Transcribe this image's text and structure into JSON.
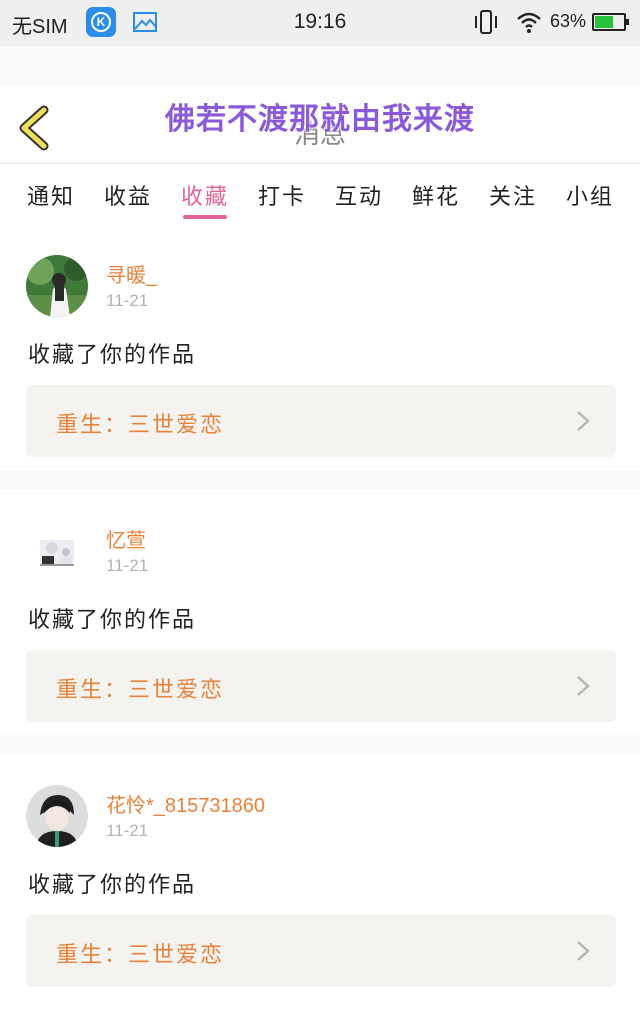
{
  "status_bar": {
    "carrier": "无SIM",
    "time": "19:16",
    "battery_percent": "63%",
    "battery_level": 0.63,
    "icons": [
      "k-app-icon",
      "gallery-icon",
      "vibrate-icon",
      "wifi-icon",
      "battery-icon"
    ]
  },
  "header": {
    "title": "消息",
    "overlay_text": "佛若不渡那就由我来渡"
  },
  "tabs": [
    {
      "label": "通知"
    },
    {
      "label": "收益"
    },
    {
      "label": "收藏"
    },
    {
      "label": "打卡"
    },
    {
      "label": "互动"
    },
    {
      "label": "鲜花"
    },
    {
      "label": "关注"
    },
    {
      "label": "小组"
    }
  ],
  "active_tab": "收藏",
  "items": [
    {
      "user": "寻暖_",
      "time": "11-21",
      "action": "收藏了你的作品",
      "work": "重生：三世爱恋"
    },
    {
      "user": "忆萱",
      "time": "11-21",
      "action": "收藏了你的作品",
      "work": "重生：三世爱恋"
    },
    {
      "user": "花怜*_815731860",
      "time": "11-21",
      "action": "收藏了你的作品",
      "work": "重生：三世爱恋"
    }
  ],
  "colors": {
    "accent_pink": "#e0669a",
    "accent_orange": "#e7823a",
    "overlay_purple": "#8a5ad8",
    "back_arrow_yellow": "#f0dd5a"
  }
}
